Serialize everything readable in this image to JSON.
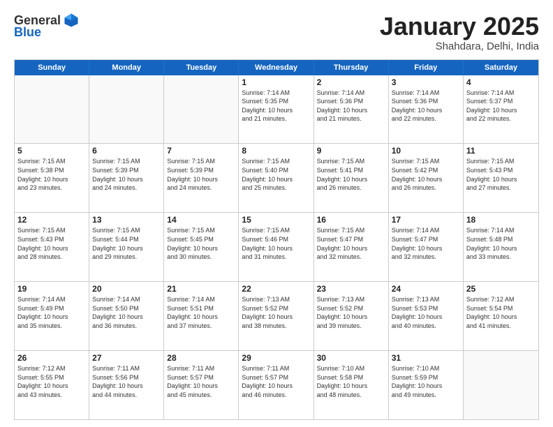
{
  "logo": {
    "general": "General",
    "blue": "Blue"
  },
  "title": "January 2025",
  "location": "Shahdara, Delhi, India",
  "days_header": [
    "Sunday",
    "Monday",
    "Tuesday",
    "Wednesday",
    "Thursday",
    "Friday",
    "Saturday"
  ],
  "rows": [
    [
      {
        "day": "",
        "text": ""
      },
      {
        "day": "",
        "text": ""
      },
      {
        "day": "",
        "text": ""
      },
      {
        "day": "1",
        "text": "Sunrise: 7:14 AM\nSunset: 5:35 PM\nDaylight: 10 hours\nand 21 minutes."
      },
      {
        "day": "2",
        "text": "Sunrise: 7:14 AM\nSunset: 5:36 PM\nDaylight: 10 hours\nand 21 minutes."
      },
      {
        "day": "3",
        "text": "Sunrise: 7:14 AM\nSunset: 5:36 PM\nDaylight: 10 hours\nand 22 minutes."
      },
      {
        "day": "4",
        "text": "Sunrise: 7:14 AM\nSunset: 5:37 PM\nDaylight: 10 hours\nand 22 minutes."
      }
    ],
    [
      {
        "day": "5",
        "text": "Sunrise: 7:15 AM\nSunset: 5:38 PM\nDaylight: 10 hours\nand 23 minutes."
      },
      {
        "day": "6",
        "text": "Sunrise: 7:15 AM\nSunset: 5:39 PM\nDaylight: 10 hours\nand 24 minutes."
      },
      {
        "day": "7",
        "text": "Sunrise: 7:15 AM\nSunset: 5:39 PM\nDaylight: 10 hours\nand 24 minutes."
      },
      {
        "day": "8",
        "text": "Sunrise: 7:15 AM\nSunset: 5:40 PM\nDaylight: 10 hours\nand 25 minutes."
      },
      {
        "day": "9",
        "text": "Sunrise: 7:15 AM\nSunset: 5:41 PM\nDaylight: 10 hours\nand 26 minutes."
      },
      {
        "day": "10",
        "text": "Sunrise: 7:15 AM\nSunset: 5:42 PM\nDaylight: 10 hours\nand 26 minutes."
      },
      {
        "day": "11",
        "text": "Sunrise: 7:15 AM\nSunset: 5:43 PM\nDaylight: 10 hours\nand 27 minutes."
      }
    ],
    [
      {
        "day": "12",
        "text": "Sunrise: 7:15 AM\nSunset: 5:43 PM\nDaylight: 10 hours\nand 28 minutes."
      },
      {
        "day": "13",
        "text": "Sunrise: 7:15 AM\nSunset: 5:44 PM\nDaylight: 10 hours\nand 29 minutes."
      },
      {
        "day": "14",
        "text": "Sunrise: 7:15 AM\nSunset: 5:45 PM\nDaylight: 10 hours\nand 30 minutes."
      },
      {
        "day": "15",
        "text": "Sunrise: 7:15 AM\nSunset: 5:46 PM\nDaylight: 10 hours\nand 31 minutes."
      },
      {
        "day": "16",
        "text": "Sunrise: 7:15 AM\nSunset: 5:47 PM\nDaylight: 10 hours\nand 32 minutes."
      },
      {
        "day": "17",
        "text": "Sunrise: 7:14 AM\nSunset: 5:47 PM\nDaylight: 10 hours\nand 32 minutes."
      },
      {
        "day": "18",
        "text": "Sunrise: 7:14 AM\nSunset: 5:48 PM\nDaylight: 10 hours\nand 33 minutes."
      }
    ],
    [
      {
        "day": "19",
        "text": "Sunrise: 7:14 AM\nSunset: 5:49 PM\nDaylight: 10 hours\nand 35 minutes."
      },
      {
        "day": "20",
        "text": "Sunrise: 7:14 AM\nSunset: 5:50 PM\nDaylight: 10 hours\nand 36 minutes."
      },
      {
        "day": "21",
        "text": "Sunrise: 7:14 AM\nSunset: 5:51 PM\nDaylight: 10 hours\nand 37 minutes."
      },
      {
        "day": "22",
        "text": "Sunrise: 7:13 AM\nSunset: 5:52 PM\nDaylight: 10 hours\nand 38 minutes."
      },
      {
        "day": "23",
        "text": "Sunrise: 7:13 AM\nSunset: 5:52 PM\nDaylight: 10 hours\nand 39 minutes."
      },
      {
        "day": "24",
        "text": "Sunrise: 7:13 AM\nSunset: 5:53 PM\nDaylight: 10 hours\nand 40 minutes."
      },
      {
        "day": "25",
        "text": "Sunrise: 7:12 AM\nSunset: 5:54 PM\nDaylight: 10 hours\nand 41 minutes."
      }
    ],
    [
      {
        "day": "26",
        "text": "Sunrise: 7:12 AM\nSunset: 5:55 PM\nDaylight: 10 hours\nand 43 minutes."
      },
      {
        "day": "27",
        "text": "Sunrise: 7:11 AM\nSunset: 5:56 PM\nDaylight: 10 hours\nand 44 minutes."
      },
      {
        "day": "28",
        "text": "Sunrise: 7:11 AM\nSunset: 5:57 PM\nDaylight: 10 hours\nand 45 minutes."
      },
      {
        "day": "29",
        "text": "Sunrise: 7:11 AM\nSunset: 5:57 PM\nDaylight: 10 hours\nand 46 minutes."
      },
      {
        "day": "30",
        "text": "Sunrise: 7:10 AM\nSunset: 5:58 PM\nDaylight: 10 hours\nand 48 minutes."
      },
      {
        "day": "31",
        "text": "Sunrise: 7:10 AM\nSunset: 5:59 PM\nDaylight: 10 hours\nand 49 minutes."
      },
      {
        "day": "",
        "text": ""
      }
    ]
  ]
}
